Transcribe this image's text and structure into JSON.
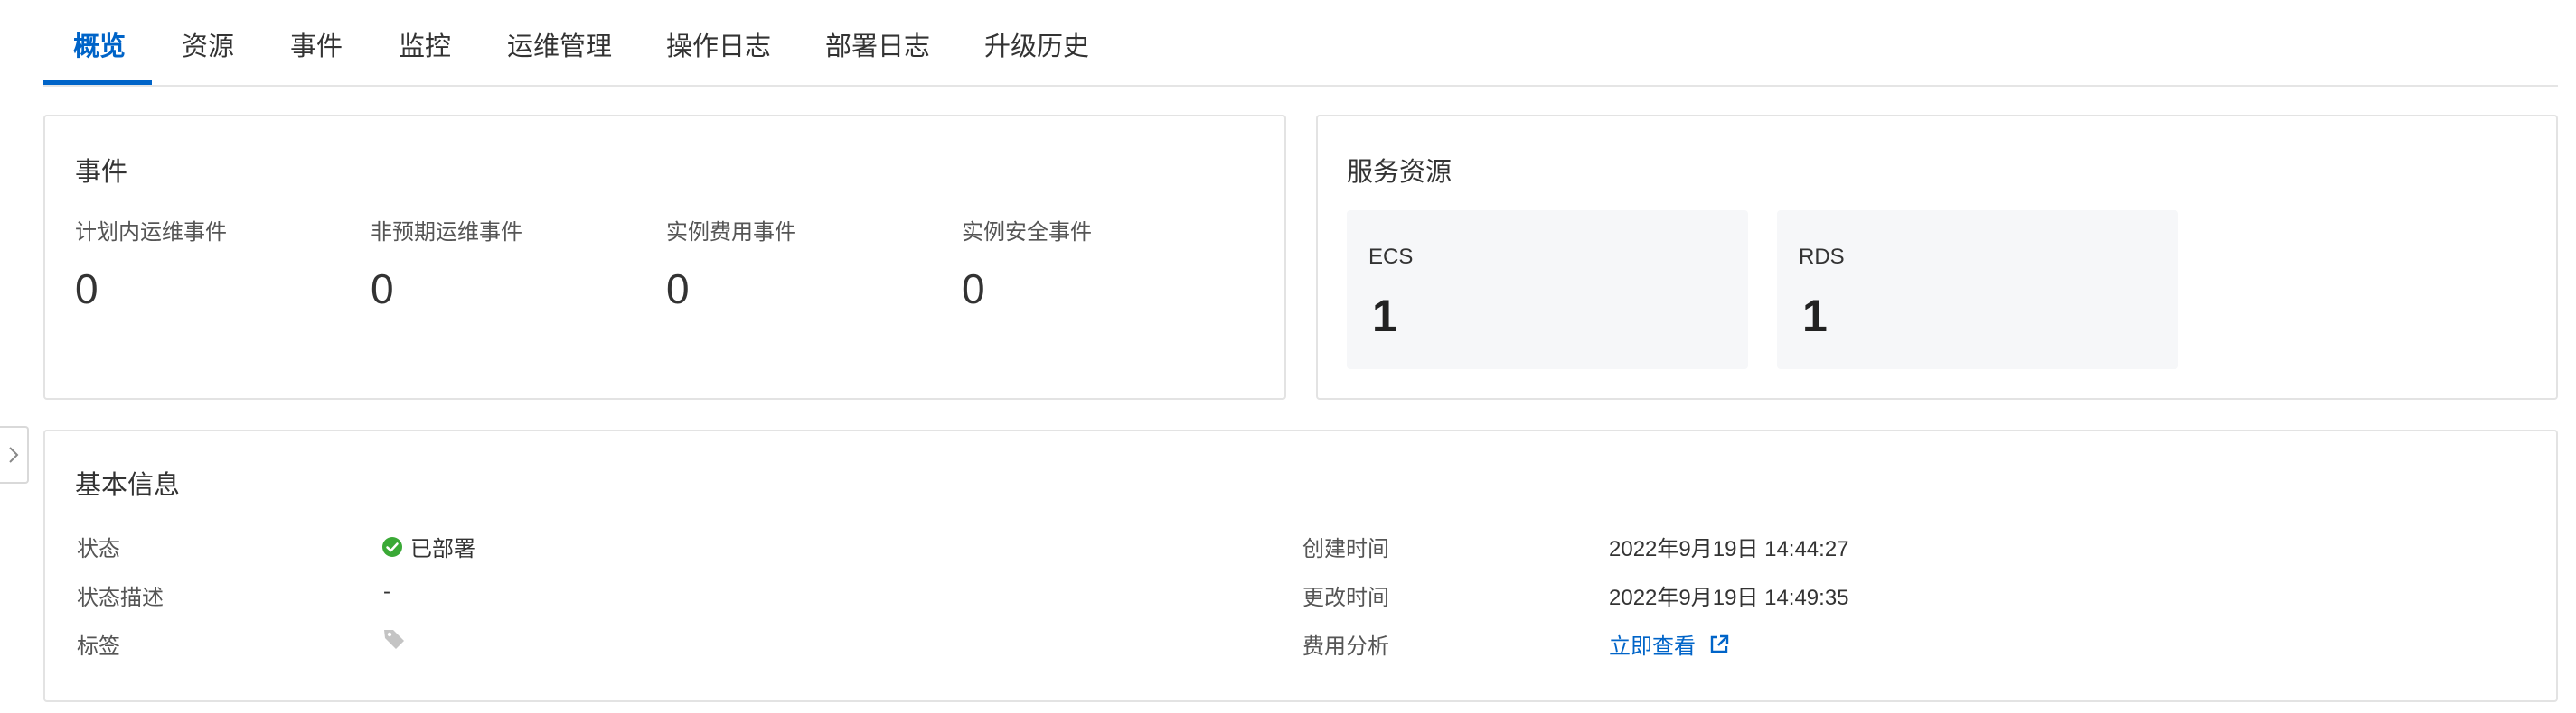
{
  "tabs": [
    {
      "label": "概览",
      "active": true
    },
    {
      "label": "资源"
    },
    {
      "label": "事件"
    },
    {
      "label": "监控"
    },
    {
      "label": "运维管理"
    },
    {
      "label": "操作日志"
    },
    {
      "label": "部署日志"
    },
    {
      "label": "升级历史"
    }
  ],
  "events_card": {
    "title": "事件",
    "items": [
      {
        "label": "计划内运维事件",
        "value": "0"
      },
      {
        "label": "非预期运维事件",
        "value": "0"
      },
      {
        "label": "实例费用事件",
        "value": "0"
      },
      {
        "label": "实例安全事件",
        "value": "0"
      }
    ]
  },
  "services_card": {
    "title": "服务资源",
    "items": [
      {
        "name": "ECS",
        "count": "1"
      },
      {
        "name": "RDS",
        "count": "1"
      }
    ]
  },
  "basic_card": {
    "title": "基本信息",
    "status_label": "状态",
    "status_value": "已部署",
    "status_color": "#3aa936",
    "status_desc_label": "状态描述",
    "status_desc_value": "-",
    "tags_label": "标签",
    "tag_icon": "tag-icon",
    "created_label": "创建时间",
    "created_value": "2022年9月19日 14:44:27",
    "modified_label": "更改时间",
    "modified_value": "2022年9月19日 14:49:35",
    "cost_label": "费用分析",
    "cost_link": "立即查看",
    "cost_link_icon": "external-link-icon"
  },
  "colors": {
    "accent": "#0064c8",
    "border": "#e3e3e3",
    "service_box_bg": "#f6f7f9"
  }
}
